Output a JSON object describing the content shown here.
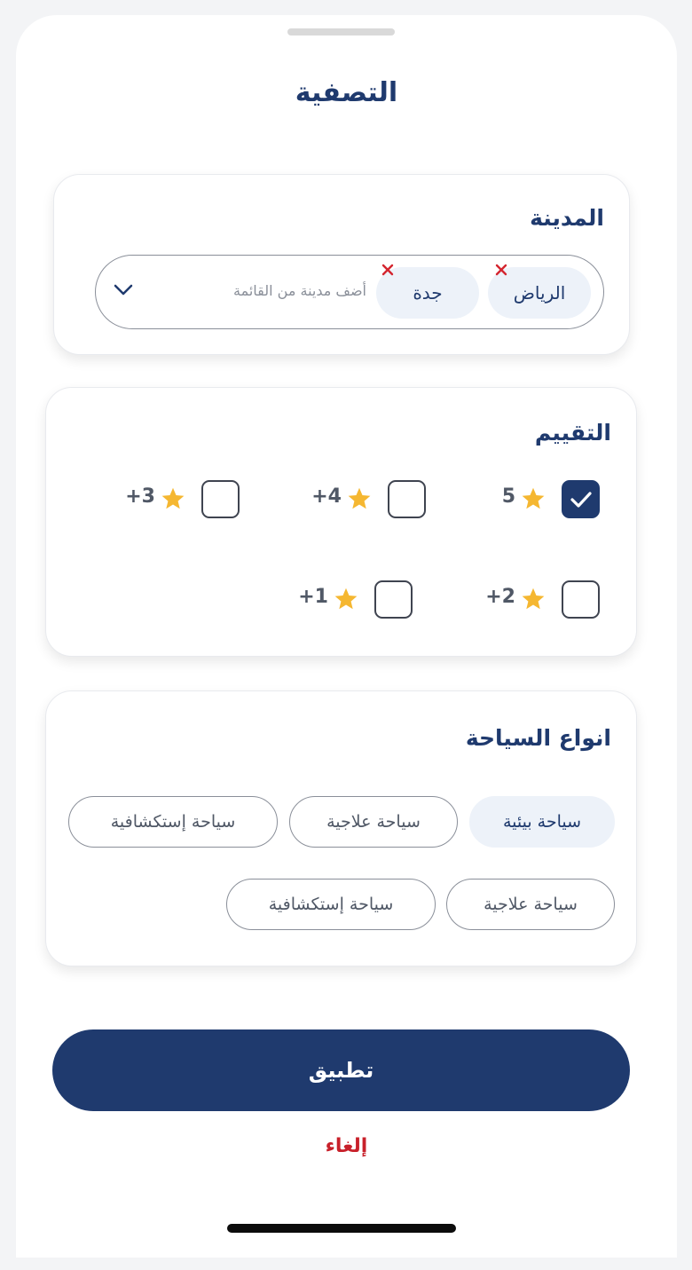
{
  "sheet": {
    "title": "التصفية"
  },
  "city": {
    "title": "المدينة",
    "placeholder": "أضف مدينة من القائمة",
    "chips": [
      {
        "label": "الرياض"
      },
      {
        "label": "جدة"
      }
    ]
  },
  "rating": {
    "title": "التقييم",
    "options": [
      {
        "label": "5",
        "checked": true
      },
      {
        "label": "+4",
        "checked": false
      },
      {
        "label": "+3",
        "checked": false
      },
      {
        "label": "+2",
        "checked": false
      },
      {
        "label": "+1",
        "checked": false
      }
    ]
  },
  "tourism": {
    "title": "انواع السياحة",
    "options": [
      {
        "label": "سياحة بيئية",
        "selected": true
      },
      {
        "label": "سياحة علاجية",
        "selected": false
      },
      {
        "label": "سياحة إستكشافية",
        "selected": false
      },
      {
        "label": "سياحة علاجية",
        "selected": false
      },
      {
        "label": "سياحة إستكشافية",
        "selected": false
      }
    ]
  },
  "actions": {
    "apply": "تطبيق",
    "cancel": "إلغاء"
  },
  "colors": {
    "primary": "#1f3a6e",
    "chip_bg": "#edf2f9",
    "star": "#f5b731",
    "danger": "#c8202a"
  },
  "icons": {
    "remove": "close-icon",
    "dropdown": "chevron-down-icon",
    "rating": "star-icon",
    "check": "check-icon"
  }
}
